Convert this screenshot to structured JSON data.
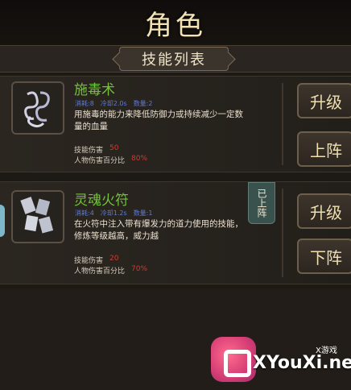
{
  "header": {
    "title": "角色"
  },
  "section": {
    "title": "技能列表"
  },
  "skills": [
    {
      "name": "施毒术",
      "stats": [
        "消耗:8",
        "冷却2.0s",
        "数量:2"
      ],
      "description": "用施毒的能力来降低防御力或持续减少一定数量的血量",
      "metric1_label": "技能伤害",
      "metric1_value": "50",
      "metric2_label": "人物伤害百分比",
      "metric2_value": "80%",
      "buttons": [
        "升级",
        "上阵"
      ],
      "badge": ""
    },
    {
      "name": "灵魂火符",
      "stats": [
        "消耗:4",
        "冷却1.2s",
        "数量:1"
      ],
      "description": "在火符中注入带有爆发力的道力使用的技能，修炼等级越高，威力越",
      "metric1_label": "技能伤害",
      "metric1_value": "20",
      "metric2_label": "人物伤害百分比",
      "metric2_value": "70%",
      "buttons": [
        "升级",
        "下阵"
      ],
      "badge": "已上阵"
    }
  ],
  "watermark": {
    "brand": "XYouXi.net",
    "top_text": "X游戏"
  },
  "colors": {
    "skill_name": "#73c23a",
    "stat_text": "#5f7bd6",
    "value_red": "#d33a2f",
    "badge_bg": "#39524e"
  },
  "icons": [
    "poison-swirl-icon",
    "talisman-cards-icon"
  ]
}
